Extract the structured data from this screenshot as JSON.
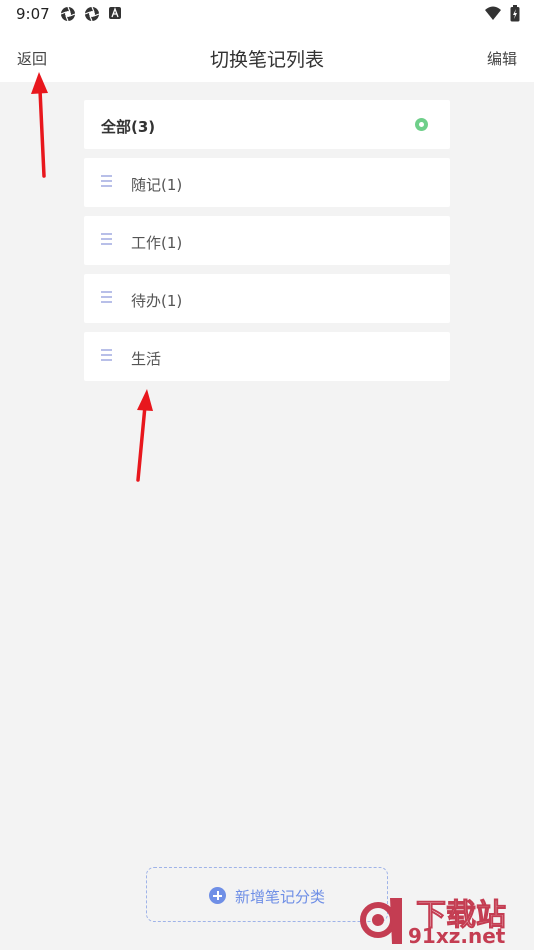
{
  "status_bar": {
    "time": "9:07",
    "left_icons": [
      "aperture-icon",
      "aperture-icon",
      "keyboard-a-icon"
    ],
    "right_icons": [
      "wifi-icon",
      "battery-icon"
    ]
  },
  "header": {
    "back_label": "返回",
    "title": "切换笔记列表",
    "edit_label": "编辑"
  },
  "categories": {
    "all_label": "全部(3)",
    "items": [
      {
        "label": "随记(1)"
      },
      {
        "label": "工作(1)"
      },
      {
        "label": "待办(1)"
      },
      {
        "label": "生活"
      }
    ]
  },
  "add_button": {
    "label": "新增笔记分类"
  },
  "watermark": {
    "top": "下载站",
    "bottom": "91xz.net"
  },
  "colors": {
    "accent": "#6f8fe6",
    "selected_dot": "#6fcf8a",
    "annotation_arrow": "#e8171d",
    "watermark": "#c43d52"
  }
}
